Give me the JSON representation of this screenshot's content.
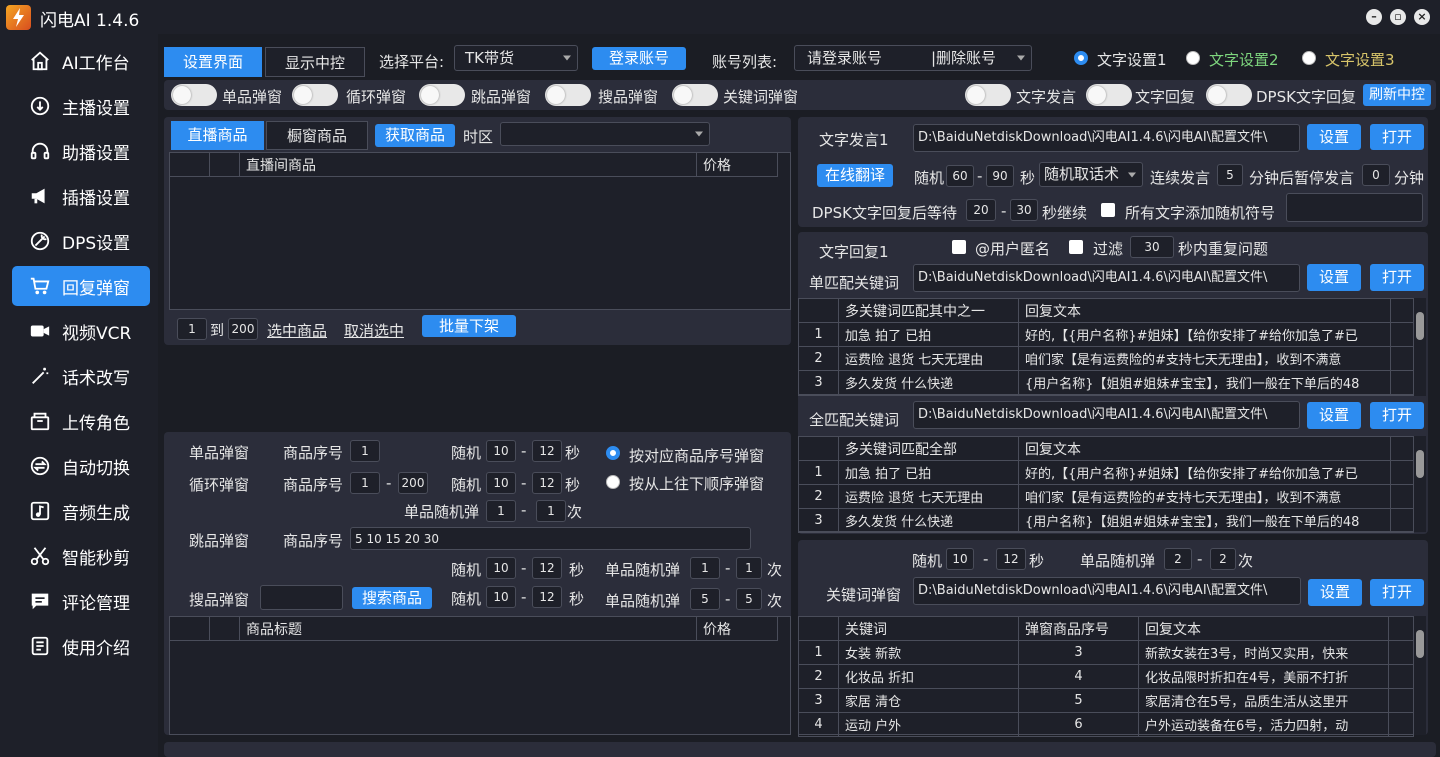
{
  "app": {
    "title": "闪电AI 1.4.6"
  },
  "sidebar": {
    "items": [
      {
        "label": "AI工作台",
        "icon": "home-icon"
      },
      {
        "label": "主播设置",
        "icon": "anchor-icon"
      },
      {
        "label": "助播设置",
        "icon": "headset-icon"
      },
      {
        "label": "插播设置",
        "icon": "megaphone-icon"
      },
      {
        "label": "DPS设置",
        "icon": "wrench-icon"
      },
      {
        "label": "回复弹窗",
        "icon": "cart-icon"
      },
      {
        "label": "视频VCR",
        "icon": "video-icon"
      },
      {
        "label": "话术改写",
        "icon": "magic-wand-icon"
      },
      {
        "label": "上传角色",
        "icon": "box-icon"
      },
      {
        "label": "自动切换",
        "icon": "switch-icon"
      },
      {
        "label": "音频生成",
        "icon": "music-icon"
      },
      {
        "label": "智能秒剪",
        "icon": "scissors-icon"
      },
      {
        "label": "评论管理",
        "icon": "comment-icon"
      },
      {
        "label": "使用介绍",
        "icon": "document-icon"
      }
    ],
    "active": "回复弹窗"
  },
  "topbar": {
    "tab_settings": "设置界面",
    "tab_display": "显示中控",
    "platform_label": "选择平台:",
    "platform_value": "TK带货",
    "login_button": "登录账号",
    "account_label": "账号列表:",
    "account_value": "请登录账号",
    "delete_account": "|删除账号",
    "text_setting_1": "文字设置1",
    "text_setting_2": "文字设置2",
    "text_setting_3": "文字设置3"
  },
  "toggles": {
    "single": "单品弹窗",
    "loop": "循环弹窗",
    "jump": "跳品弹窗",
    "search": "搜品弹窗",
    "keyword": "关键词弹窗",
    "text_speak": "文字发言",
    "text_reply": "文字回复",
    "dpsk_reply": "DPSK文字回复",
    "refresh": "刷新中控"
  },
  "products": {
    "tab_live": "直播商品",
    "tab_window": "橱窗商品",
    "fetch_button": "获取商品",
    "timezone_label": "时区",
    "col_name": "直播间商品",
    "col_price": "价格",
    "range_from": "1",
    "range_to_label": "到",
    "range_to": "200",
    "select_link": "选中商品",
    "deselect_link": "取消选中",
    "batch_remove": "批量下架"
  },
  "popup": {
    "single_label": "单品弹窗",
    "product_no": "商品序号",
    "single_no": "1",
    "random": "随机",
    "single_min": "10",
    "single_max": "12",
    "sec": "秒",
    "radio_by_index": "按对应商品序号弹窗",
    "radio_top_down": "按从上往下顺序弹窗",
    "loop_label": "循环弹窗",
    "loop_from": "1",
    "loop_to": "200",
    "loop_min": "10",
    "loop_max": "12",
    "single_random_label": "单品随机弹",
    "single_random_min": "1",
    "single_random_max": "1",
    "times": "次",
    "jump_label": "跳品弹窗",
    "jump_list": "5 10 15 20 30",
    "jump_min": "10",
    "jump_max": "12",
    "jump_rand_min": "1",
    "jump_rand_max": "1",
    "search_label": "搜品弹窗",
    "search_button": "搜索商品",
    "search_min": "10",
    "search_max": "12",
    "search_rand_min": "5",
    "search_rand_max": "5",
    "col_title": "商品标题",
    "col_price": "价格",
    "dash": "-"
  },
  "speak": {
    "label": "文字发言1",
    "path": "D:\\BaiduNetdiskDownload\\闪电AI1.4.6\\闪电AI\\配置文件\\",
    "settings": "设置",
    "open": "打开",
    "translate": "在线翻译",
    "random": "随机",
    "min": "60",
    "max": "90",
    "sec": "秒",
    "mode": "随机取话术",
    "continuous": "连续发言",
    "cont_min": "5",
    "pause_label": "分钟后暂停发言",
    "pause_min": "0",
    "minute": "分钟",
    "dpsk_wait": "DPSK文字回复后等待",
    "dpsk_min": "20",
    "dpsk_max": "30",
    "dpsk_continue": "秒继续",
    "add_random": "所有文字添加随机符号"
  },
  "reply": {
    "label": "文字回复1",
    "anon": "@用户匿名",
    "filter": "过滤",
    "filter_sec": "30",
    "filter_suffix": "秒内重复问题",
    "single_match": "单匹配关键词",
    "path": "D:\\BaiduNetdiskDownload\\闪电AI1.4.6\\闪电AI\\配置文件\\",
    "settings": "设置",
    "open": "打开",
    "table1": {
      "col_kw": "多关键词匹配其中之一",
      "col_text": "回复文本",
      "rows": [
        {
          "n": "1",
          "kw": "加急 拍了 已拍",
          "text": "好的,【{用户名称}#姐妹】【给你安排了#给你加急了#已"
        },
        {
          "n": "2",
          "kw": "运费险 退货 七天无理由",
          "text": "咱们家【是有运费险的#支持七天无理由】，收到不满意"
        },
        {
          "n": "3",
          "kw": "多久发货 什么快递",
          "text": "{用户名称}【姐姐#姐妹#宝宝】，我们一般在下单后的48"
        }
      ]
    },
    "full_match": "全匹配关键词",
    "table2": {
      "col_kw": "多关键词匹配全部",
      "col_text": "回复文本",
      "rows": [
        {
          "n": "1",
          "kw": "加急 拍了 已拍",
          "text": "好的,【{用户名称}#姐妹】【给你安排了#给你加急了#已"
        },
        {
          "n": "2",
          "kw": "运费险 退货 七天无理由",
          "text": "咱们家【是有运费险的#支持七天无理由】，收到不满意"
        },
        {
          "n": "3",
          "kw": "多久发货 什么快递",
          "text": "{用户名称}【姐姐#姐妹#宝宝】，我们一般在下单后的48"
        }
      ]
    }
  },
  "keyword_popup": {
    "random": "随机",
    "min": "10",
    "max": "12",
    "sec": "秒",
    "single_random": "单品随机弹",
    "rand_min": "2",
    "rand_max": "2",
    "times": "次",
    "label": "关键词弹窗",
    "path": "D:\\BaiduNetdiskDownload\\闪电AI1.4.6\\闪电AI\\配置文件\\",
    "settings": "设置",
    "open": "打开",
    "col_kw": "关键词",
    "col_no": "弹窗商品序号",
    "col_text": "回复文本",
    "rows": [
      {
        "n": "1",
        "kw": "女装 新款",
        "no": "3",
        "text": "新款女装在3号，时尚又实用，快来"
      },
      {
        "n": "2",
        "kw": "化妆品 折扣",
        "no": "4",
        "text": "化妆品限时折扣在4号，美丽不打折"
      },
      {
        "n": "3",
        "kw": "家居 清仓",
        "no": "5",
        "text": "家居清仓在5号，品质生活从这里开"
      },
      {
        "n": "4",
        "kw": "运动 户外",
        "no": "6",
        "text": "户外运动装备在6号，活力四射，动"
      }
    ]
  }
}
